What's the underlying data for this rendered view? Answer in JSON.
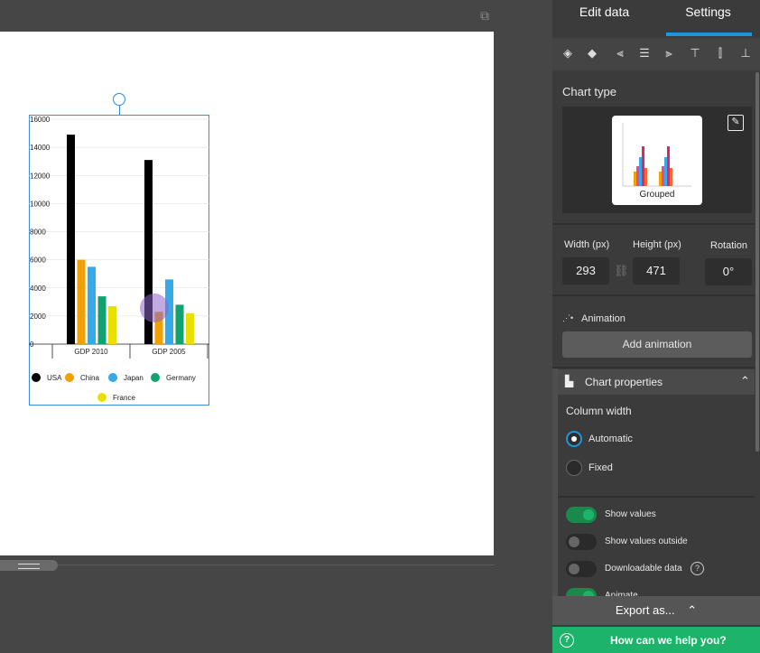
{
  "panel": {
    "tabs": [
      {
        "label": "Edit data"
      },
      {
        "label": "Settings"
      }
    ],
    "chart_type_label": "Chart type",
    "chart_type_value": "Grouped",
    "width_label": "Width (px)",
    "height_label": "Height (px)",
    "rotation_label": "Rotation",
    "width_value": "293",
    "height_value": "471",
    "rotation_value": "0°",
    "animation_label": "Animation",
    "add_animation": "Add animation",
    "chart_properties": "Chart properties",
    "column_width": "Column width",
    "radio_automatic": "Automatic",
    "radio_fixed": "Fixed",
    "toggles": [
      {
        "label": "Show values",
        "on": true
      },
      {
        "label": "Show values outside",
        "on": false
      },
      {
        "label": "Downloadable data",
        "on": false
      },
      {
        "label": "Animate",
        "on": true
      }
    ],
    "export": "Export as...",
    "help": "How can we help you?"
  },
  "colors": {
    "accent": "#1f96d8",
    "green": "#1db36a"
  },
  "chart_data": {
    "type": "bar",
    "categories": [
      "GDP 2010",
      "GDP 2005"
    ],
    "series": [
      {
        "name": "USA",
        "color": "#000000",
        "values": [
          14900,
          13100
        ]
      },
      {
        "name": "China",
        "color": "#f0a000",
        "values": [
          6000,
          2300
        ]
      },
      {
        "name": "Japan",
        "color": "#36a9e8",
        "values": [
          5500,
          4600
        ]
      },
      {
        "name": "Germany",
        "color": "#12a170",
        "values": [
          3400,
          2800
        ]
      },
      {
        "name": "France",
        "color": "#e8e000",
        "values": [
          2700,
          2200
        ]
      }
    ],
    "ylim": [
      0,
      16000
    ],
    "yticks": [
      "0",
      "2000",
      "4000",
      "6000",
      "8000",
      "10000",
      "12000",
      "14000",
      "16000"
    ],
    "grid": true,
    "legend": "bottom"
  }
}
